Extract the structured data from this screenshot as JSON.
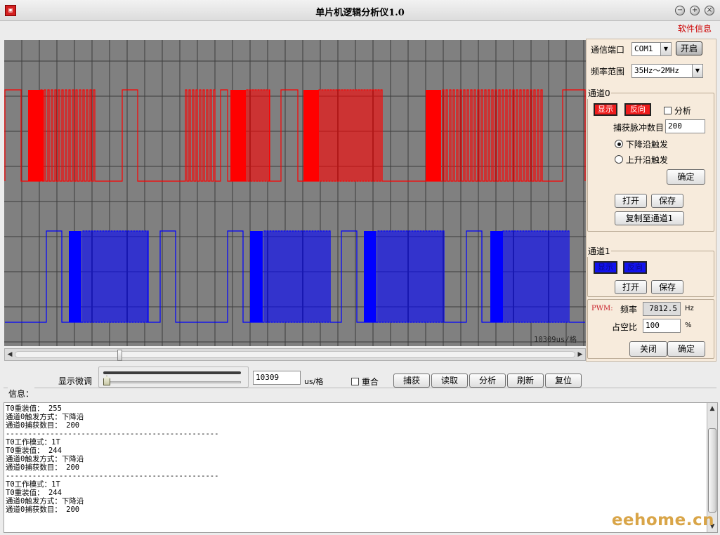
{
  "window": {
    "title": "单片机逻辑分析仪1.0",
    "icon": "app-logo-icon",
    "controls": [
      "minimize-icon",
      "maximize-icon",
      "close-icon"
    ]
  },
  "menu": {
    "info": "软件信息"
  },
  "scope": {
    "scale_label": "10309us/格",
    "colors": {
      "bg": "#808080",
      "grid": "#3c3c3c",
      "ch0": "#ff0000",
      "ch1": "#0000ff"
    }
  },
  "panel": {
    "port_label": "通信端口",
    "port_value": "COM1",
    "open_label": "开启",
    "freq_label": "频率范围",
    "freq_value": "35Hz～2MHz",
    "ch0": {
      "title": "通道0",
      "show_label": "显示",
      "invert_label": "反向",
      "analyze_label": "分析",
      "pulse_label": "捕获脉冲数目",
      "pulse_value": "200",
      "falling_label": "下降沿触发",
      "rising_label": "上升沿触发",
      "confirm_label": "确定",
      "open_label": "打开",
      "save_label": "保存",
      "copy_label": "复制至通道1"
    },
    "ch1": {
      "title": "通道1",
      "show_label": "显示",
      "invert_label": "反向",
      "open_label": "打开",
      "save_label": "保存"
    },
    "pwm": {
      "tag": "PWM:",
      "freq_label": "频率",
      "freq_value": "7812.5",
      "freq_unit": "Hz",
      "duty_label": "占空比",
      "duty_value": "100",
      "duty_unit": "%",
      "close_label": "关闭",
      "confirm_label": "确定"
    }
  },
  "controls": {
    "fine_label": "显示微调",
    "scale_value": "10309",
    "scale_unit": "us/格",
    "overlap_label": "重合",
    "buttons": [
      "捕获",
      "读取",
      "分析",
      "刷新",
      "复位"
    ]
  },
  "info": {
    "title": "信息：",
    "lines": [
      "T0重装值： 255",
      "通道0触发方式：下降沿",
      "通道0捕获数目： 200",
      "------------------------------------------------",
      "T0工作模式：1T",
      "T0重装值： 244",
      "通道0触发方式：下降沿",
      "通道0捕获数目： 200",
      "------------------------------------------------",
      "T0工作模式：1T",
      "T0重装值： 244",
      "通道0触发方式：下降沿",
      "通道0捕获数目： 200"
    ]
  },
  "watermark": "eehome.cn"
}
